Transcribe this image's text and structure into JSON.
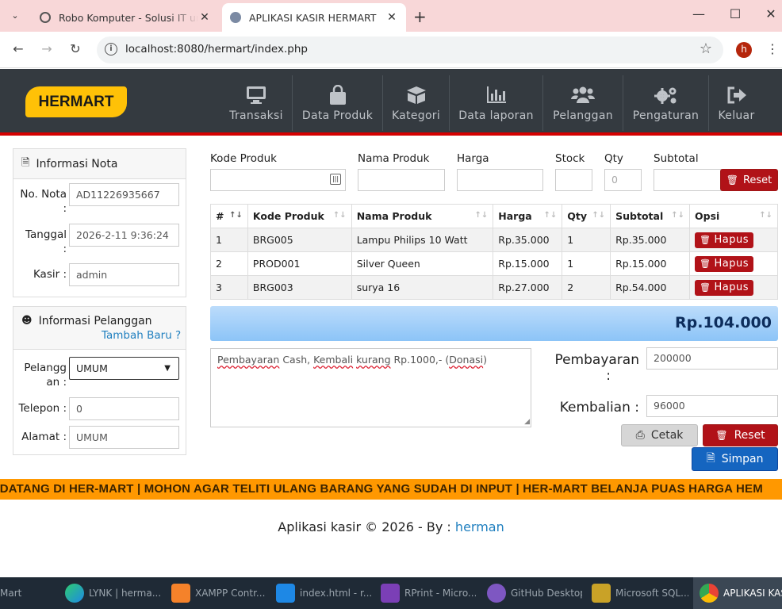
{
  "browser": {
    "tabs": [
      {
        "title": "Robo Komputer - Solusi IT untuk",
        "active": false
      },
      {
        "title": "APLIKASI KASIR HERMART",
        "active": true
      }
    ],
    "url": "localhost:8080/hermart/index.php",
    "profile_initial": "h"
  },
  "app": {
    "logo": "HERMART",
    "menu": [
      {
        "label": "Transaksi",
        "icon": "monitor-icon"
      },
      {
        "label": "Data Produk",
        "icon": "shopping-bag-icon"
      },
      {
        "label": "Kategori",
        "icon": "box-icon"
      },
      {
        "label": "Data laporan",
        "icon": "bar-chart-icon"
      },
      {
        "label": "Pelanggan",
        "icon": "users-icon"
      },
      {
        "label": "Pengaturan",
        "icon": "gears-icon"
      },
      {
        "label": "Keluar",
        "icon": "sign-out-icon"
      }
    ]
  },
  "nota": {
    "title": "Informasi Nota",
    "no_label": "No. Nota",
    "no_value": "AD11226935667",
    "tanggal_label": "Tanggal",
    "tanggal_value": "2026-2-11 9:36:24",
    "kasir_label": "Kasir :",
    "kasir_value": "admin"
  },
  "pelanggan": {
    "title": "Informasi Pelanggan",
    "tambah_link": "Tambah Baru ?",
    "pelanggan_label_1": "Pelangg",
    "pelanggan_label_2": "an :",
    "pelanggan_value": "UMUM",
    "telepon_label": "Telepon :",
    "telepon_value": "0",
    "alamat_label": "Alamat :",
    "alamat_value": "UMUM"
  },
  "entry": {
    "kode_label": "Kode Produk",
    "nama_label": "Nama Produk",
    "harga_label": "Harga",
    "stock_label": "Stock",
    "qty_label": "Qty",
    "qty_placeholder": "0",
    "subtotal_label": "Subtotal",
    "reset_label": "Reset"
  },
  "table": {
    "headers": [
      "#",
      "Kode Produk",
      "Nama Produk",
      "Harga",
      "Qty",
      "Subtotal",
      "Opsi"
    ],
    "rows": [
      {
        "no": "1",
        "kode": "BRG005",
        "nama": "Lampu Philips 10 Watt",
        "harga": "Rp.35.000",
        "qty": "1",
        "subtotal": "Rp.35.000"
      },
      {
        "no": "2",
        "kode": "PROD001",
        "nama": "Silver Queen",
        "harga": "Rp.15.000",
        "qty": "1",
        "subtotal": "Rp.15.000"
      },
      {
        "no": "3",
        "kode": "BRG003",
        "nama": "surya 16",
        "harga": "Rp.27.000",
        "qty": "2",
        "subtotal": "Rp.54.000"
      }
    ],
    "hapus_label": "Hapus"
  },
  "total": "Rp.104.000",
  "note": {
    "w1": "Pembayaran",
    "w2": "Cash,",
    "w3": "Kembali",
    "w4": "kurang",
    "w5": "Rp.1000,- (",
    "w6": "Donasi",
    "w7": ")"
  },
  "payment": {
    "pembayaran_label": "Pembayaran",
    "pembayaran_colon": ":",
    "pembayaran_value": "200000",
    "kembalian_label": "Kembalian :",
    "kembalian_value": "96000",
    "cetak_label": "Cetak",
    "reset_label": "Reset",
    "simpan_label": "Simpan"
  },
  "marquee": "T DATANG DI HER-MART | MOHON AGAR TELITI ULANG BARANG YANG SUDAH DI INPUT | HER-MART BELANJA PUAS HARGA HEM",
  "footer": {
    "text": "Aplikasi kasir © 2026 - By :",
    "author": "herman"
  },
  "taskbar": [
    {
      "label": "Mart"
    },
    {
      "label": "LYNK | herma..."
    },
    {
      "label": "XAMPP Contr..."
    },
    {
      "label": "index.html - r..."
    },
    {
      "label": "RPrint - Micro..."
    },
    {
      "label": "GitHub Desktop"
    },
    {
      "label": "Microsoft SQL..."
    },
    {
      "label": "APLIKASI KASI"
    }
  ]
}
